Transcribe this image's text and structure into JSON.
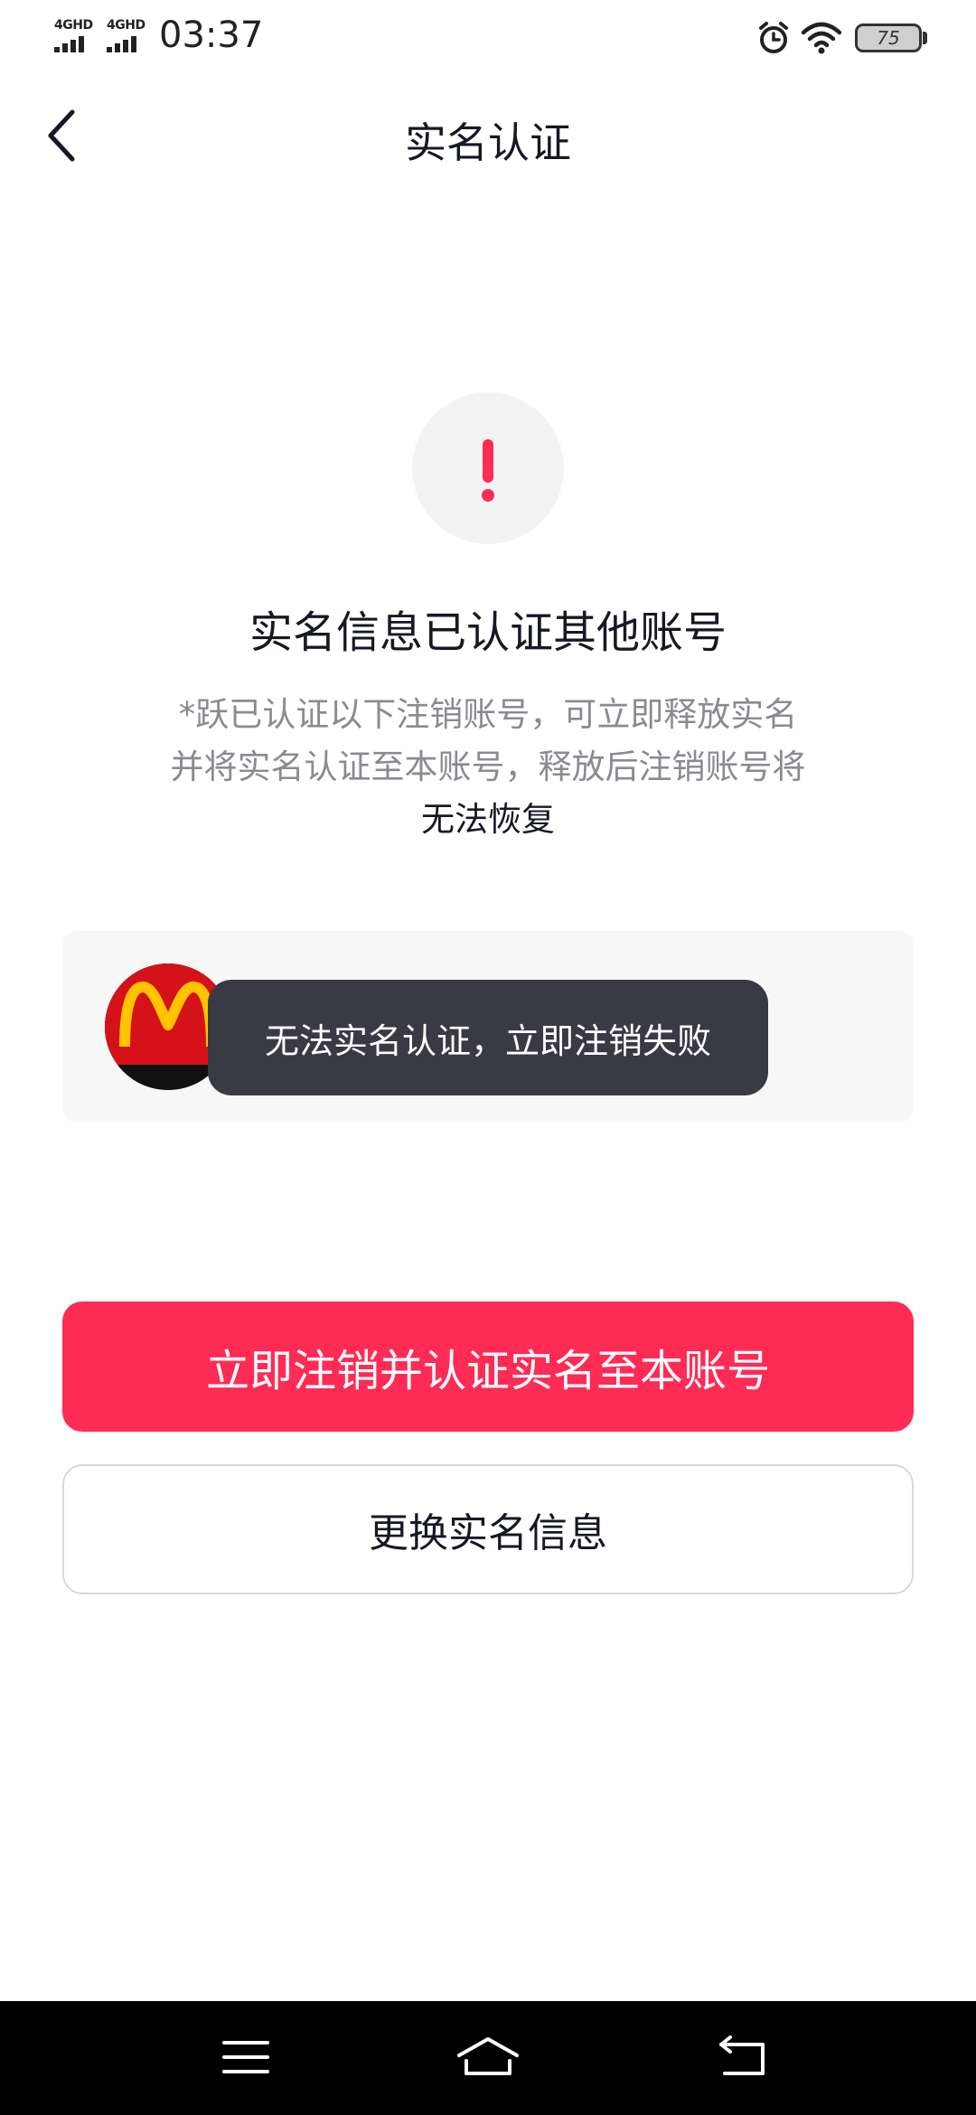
{
  "status_bar": {
    "network_1": "4GHD",
    "network_2": "4GHD",
    "time": "03:37",
    "battery": "75"
  },
  "header": {
    "title": "实名认证"
  },
  "main": {
    "headline": "实名信息已认证其他账号",
    "description_prefix": "*跃已认证以下注销账号，可立即释放实名并将实名认证至本账号，释放后注销账号将",
    "description_emphasis": "无法恢复"
  },
  "account_card": {
    "avatar_icon": "mcdonalds-logo"
  },
  "toast": {
    "message": "无法实名认证，立即注销失败"
  },
  "buttons": {
    "primary_label": "立即注销并认证实名至本账号",
    "secondary_label": "更换实名信息"
  },
  "colors": {
    "accent": "#fe2c55",
    "toast_bg": "#393a43",
    "card_bg": "#f7f7f8"
  },
  "system_nav": {
    "menu_icon": "menu-icon",
    "home_icon": "home-icon",
    "back_icon": "back-icon"
  }
}
